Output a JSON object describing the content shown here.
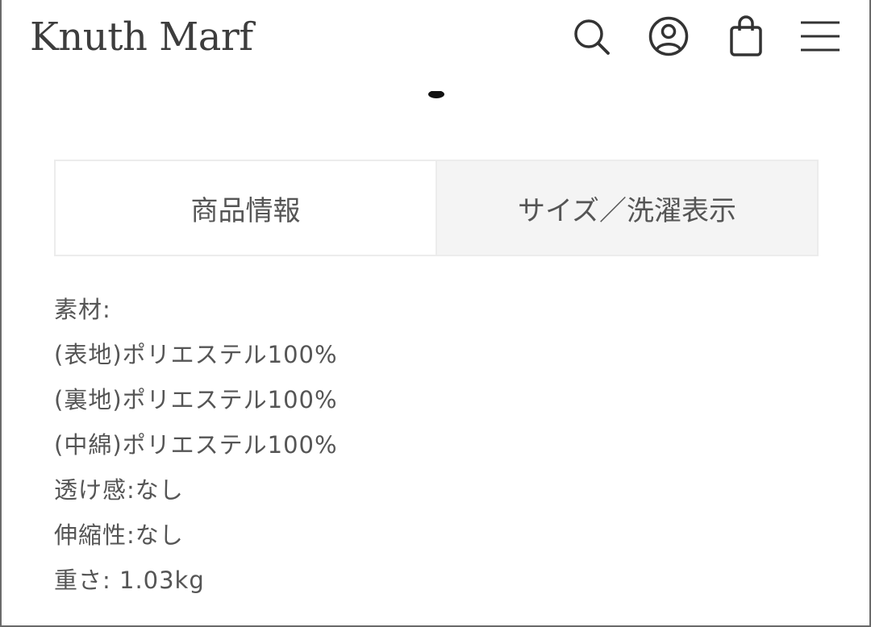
{
  "header": {
    "brand": "Knuth Marf",
    "icons": [
      "search-icon",
      "account-icon",
      "shopping-bag-icon",
      "menu-icon"
    ]
  },
  "tabs": [
    {
      "label": "商品情報",
      "active": true
    },
    {
      "label": "サイズ／洗濯表示",
      "active": false
    }
  ],
  "details": [
    "素材:",
    "(表地)ポリエステル100%",
    "(裏地)ポリエステル100%",
    "(中綿)ポリエステル100%",
    "透け感:なし",
    "伸縮性:なし",
    "重さ: 1.03kg"
  ],
  "colors": {
    "text": "#555555",
    "logo": "#3d3d3d",
    "icon": "#333333",
    "tab_border": "#ececec",
    "tab_inactive_bg": "#f4f4f4"
  }
}
